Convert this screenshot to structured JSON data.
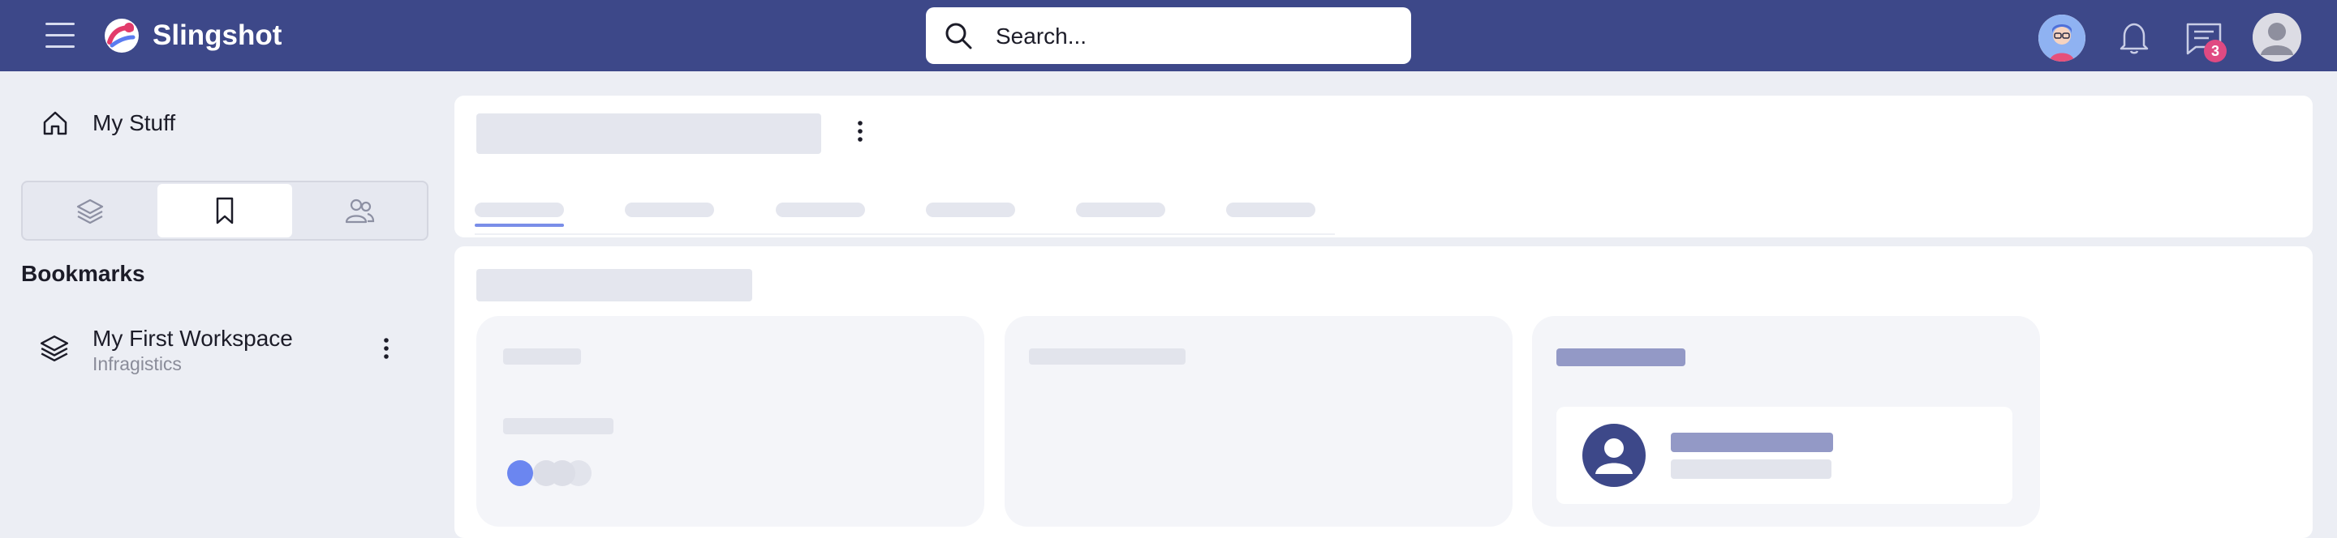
{
  "header": {
    "app_name": "Slingshot",
    "search": {
      "placeholder": "Search..."
    },
    "messages_badge": "3",
    "icons": [
      "menu-icon",
      "slingshot-logo-icon",
      "search-icon",
      "user-avatar-icon",
      "bell-icon",
      "message-icon",
      "profile-icon"
    ]
  },
  "sidebar": {
    "my_stuff_label": "My Stuff",
    "tabs": [
      {
        "icon": "layers-icon",
        "active": false
      },
      {
        "icon": "bookmark-icon",
        "active": true
      },
      {
        "icon": "users-icon",
        "active": false
      }
    ],
    "section_title": "Bookmarks",
    "workspaces": [
      {
        "name": "My First Workspace",
        "subtitle": "Infragistics",
        "icon": "layers-icon"
      }
    ]
  },
  "colors": {
    "topbar": "#3d4889",
    "accent": "#7a8ee8",
    "skeleton": "#e4e6ee",
    "skeleton_dark": "#9399c6",
    "badge": "#e04a82"
  }
}
